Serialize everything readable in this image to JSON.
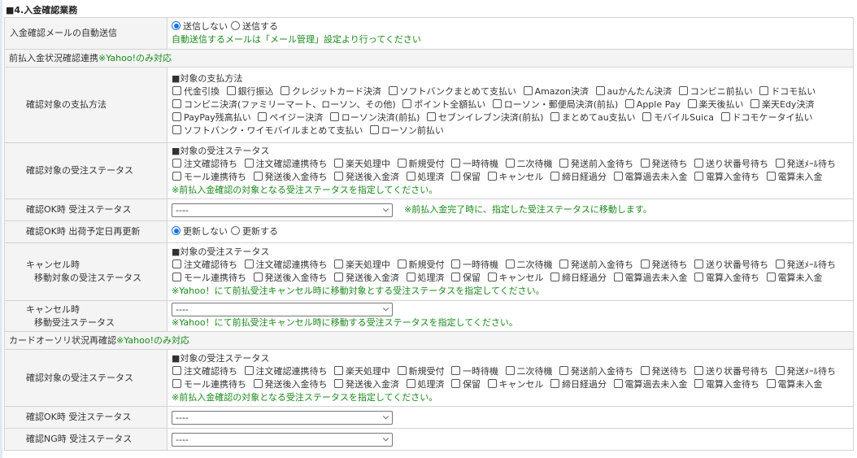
{
  "title": "■4.入金確認業務",
  "auto_mail": {
    "label": "入金確認メールの自動送信",
    "options": [
      "送信しない",
      "送信する"
    ],
    "selected": 0,
    "note": "自動送信するメールは「メール管理」設定より行ってください"
  },
  "prepay_section": {
    "label": "前払入金状況確認連携",
    "note": "※Yahoo!のみ対応"
  },
  "payment": {
    "label": "確認対象の支払方法",
    "heading": "■対象の支払方法",
    "items": [
      "代金引換",
      "銀行振込",
      "クレジットカード決済",
      "ソフトバンクまとめて支払い",
      "Amazon決済",
      "auかんたん決済",
      "コンビニ前払い",
      "ドコモ払い",
      "コンビニ決済(ファミリーマート、ローソン、その他)",
      "ポイント全額払い",
      "ローソン・郵便局決済(前払)",
      "Apple Pay",
      "楽天後払い",
      "楽天Edy決済",
      "PayPay残高払い",
      "ペイジー決済",
      "ローソン決済(前払)",
      "セブンイレブン決済(前払)",
      "まとめてau支払い",
      "モバイルSuica",
      "ドコモケータイ払い",
      "ソフトバンク・ワイモバイルまとめて支払い",
      "ローソン前払い"
    ]
  },
  "statuses": [
    "注文確認待ち",
    "注文確認連携待ち",
    "楽天処理中",
    "新規受付",
    "一時待機",
    "二次待機",
    "発送前入金待ち",
    "発送待ち",
    "送り状番号待ち",
    "発送ﾒｰﾙ待ち",
    "モール連携待ち",
    "発送後入金待ち",
    "発送後入金済",
    "処理済",
    "保留",
    "キャンセル",
    "締日経過分",
    "電算過去未入金",
    "電算入金待ち",
    "電算未入金"
  ],
  "status_heading": "■対象の受注ステータス",
  "prepay_status": {
    "label": "確認対象の受注ステータス",
    "note": "※前払入金確認の対象となる受注ステータスを指定してください。"
  },
  "prepay_ok": {
    "label": "確認OK時 受注ステータス",
    "value": "----",
    "note": "※前払入金完了時に、指定した受注ステータスに移動します。"
  },
  "ship_date": {
    "label": "確認OK時 出荷予定日再更新",
    "options": [
      "更新しない",
      "更新する"
    ],
    "selected": 0
  },
  "cancel_target": {
    "label1": "キャンセル時",
    "label2": "移動対象の受注ステータス",
    "note": "※Yahoo！にて前払受注キャンセル時に移動対象とする受注ステータスを指定してください。"
  },
  "cancel_move": {
    "label1": "キャンセル時",
    "label2": "移動受注ステータス",
    "value": "----",
    "note": "※Yahoo！にて前払受注キャンセル時に移動する受注ステータスを指定してください。"
  },
  "card_section": {
    "label": "カードオーソリ状況再確認",
    "note": "※Yahoo!のみ対応"
  },
  "card_status": {
    "label": "確認対象の受注ステータス",
    "note": "※前払入金確認の対象となる受注ステータスを指定してください。"
  },
  "card_ok": {
    "label": "確認OK時 受注ステータス",
    "value": "----"
  },
  "card_ng": {
    "label": "確認NG時 受注ステータス",
    "value": "----"
  }
}
